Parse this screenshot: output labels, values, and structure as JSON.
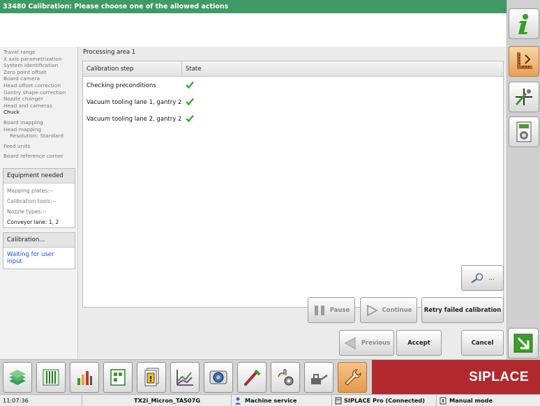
{
  "window": {
    "title": "33480 Calibration: Please choose one of the allowed actions"
  },
  "left_nav": {
    "items": [
      {
        "label": "Travel range"
      },
      {
        "label": "X axis parametrization"
      },
      {
        "label": "System identification"
      },
      {
        "label": "Zero point offset"
      },
      {
        "label": "Board camera"
      },
      {
        "label": "Head offset correction"
      },
      {
        "label": "Gantry shape correction"
      },
      {
        "label": "Nozzle changer"
      },
      {
        "label": "Head and cameras"
      },
      {
        "label": "Chuck"
      },
      {
        "label": "Board mapping"
      },
      {
        "label": "Head mapping"
      },
      {
        "label": "Resolution: Standard"
      },
      {
        "label": "Feed units"
      },
      {
        "label": "Board reference corner"
      }
    ]
  },
  "equipment": {
    "title": "Equipment needed",
    "mapping_plates": "Mapping plates:--",
    "calibration_tools": "Calibration tools:--",
    "nozzle_types": "Nozzle types:--",
    "conveyor_lane": "Conveyor lane: 1, 2"
  },
  "calibration_status": {
    "title": "Calibration...",
    "status": "Waiting for user input"
  },
  "main": {
    "area_title": "Processing area 1",
    "columns": [
      "Calibration step",
      "State"
    ],
    "rows": [
      {
        "step": "Checking preconditions",
        "state": "ok"
      },
      {
        "step": "Vacuum tooling lane 1, gantry 2",
        "state": "ok"
      },
      {
        "step": "Vacuum tooling lane 2, gantry 2",
        "state": "ok"
      }
    ]
  },
  "buttons": {
    "details": "...",
    "pause": "Pause",
    "continue": "Continue",
    "retry": "Retry failed calibration",
    "previous": "Previous",
    "accept": "Accept",
    "cancel": "Cancel"
  },
  "brand": "SIPLACE",
  "statusbar": {
    "time": "11:07:36",
    "machine": "TX2i_Micron_TA507G",
    "user_mode": "Machine service",
    "connection": "SIPLACE Pro (Connected)",
    "mode": "Manual mode"
  },
  "colors": {
    "titlebar": "#3f9a66",
    "brand": "#b1292d",
    "check": "#3aa63a",
    "link": "#1a4fd6"
  }
}
